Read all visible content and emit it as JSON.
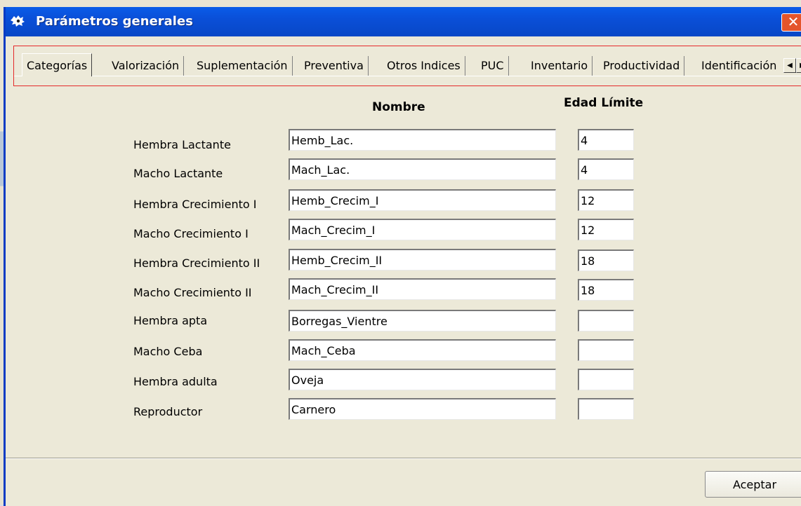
{
  "window": {
    "title": "Parámetros generales",
    "close_label": "✕"
  },
  "tabs": [
    {
      "label": "Categorías",
      "active": true
    },
    {
      "label": "Valorización"
    },
    {
      "label": "Suplementación"
    },
    {
      "label": "Preventiva"
    },
    {
      "label": "Otros Indices"
    },
    {
      "label": "PUC"
    },
    {
      "label": "Inventario"
    },
    {
      "label": "Productividad"
    },
    {
      "label": "Identificación"
    }
  ],
  "tab_scroll": {
    "left": "◀",
    "right": "▶"
  },
  "columns": {
    "name": "Nombre",
    "age": "Edad Límite"
  },
  "rows": [
    {
      "label": "Hembra Lactante",
      "name": "Hemb_Lac.",
      "age": "4"
    },
    {
      "label": "Macho Lactante",
      "name": "Mach_Lac.",
      "age": "4"
    },
    {
      "label": "Hembra Crecimiento I",
      "name": "Hemb_Crecim_I",
      "age": "12"
    },
    {
      "label": "Macho Crecimiento I",
      "name": "Mach_Crecim_I",
      "age": "12"
    },
    {
      "label": "Hembra Crecimiento II",
      "name": "Hemb_Crecim_II",
      "age": "18"
    },
    {
      "label": "Macho Crecimiento II",
      "name": "Mach_Crecim_II",
      "age": "18"
    },
    {
      "label": "Hembra apta",
      "name": "Borregas_Vientre",
      "age": ""
    },
    {
      "label": "Macho Ceba",
      "name": "Mach_Ceba",
      "age": ""
    },
    {
      "label": "Hembra adulta",
      "name": "Oveja",
      "age": ""
    },
    {
      "label": "Reproductor",
      "name": "Carnero",
      "age": ""
    }
  ],
  "buttons": {
    "accept": "Aceptar"
  },
  "colors": {
    "titlebar": "#0a4fd8",
    "close": "#e4552b",
    "focus_outline": "#e52a2a",
    "dialog_bg": "#ece9d8"
  }
}
